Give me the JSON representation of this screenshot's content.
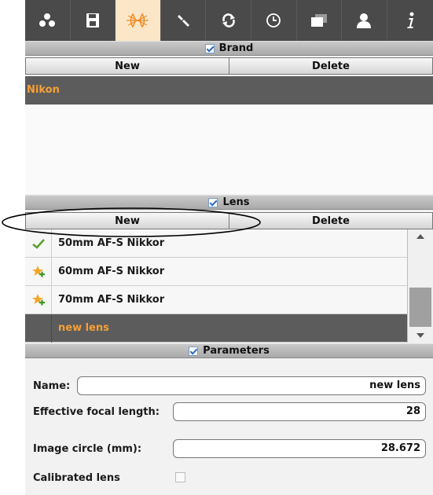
{
  "toolbar": {
    "tabs": [
      {
        "icon": "nodes-icon"
      },
      {
        "icon": "save-icon"
      },
      {
        "icon": "lens-icon",
        "active": true
      },
      {
        "icon": "wrench-icon"
      },
      {
        "icon": "refresh-icon"
      },
      {
        "icon": "clock-icon"
      },
      {
        "icon": "windows-icon"
      },
      {
        "icon": "user-icon"
      },
      {
        "icon": "info-icon"
      }
    ]
  },
  "brand": {
    "header": "Brand",
    "checked": true,
    "new_label": "New",
    "delete_label": "Delete",
    "items": [
      {
        "name": "Nikon",
        "selected": true
      }
    ]
  },
  "lens": {
    "header": "Lens",
    "checked": true,
    "new_label": "New",
    "delete_label": "Delete",
    "items": [
      {
        "name": "50mm AF-S Nikkor",
        "status_icon": "checkmark-icon"
      },
      {
        "name": "60mm AF-S Nikkor",
        "status_icon": "star-plus-icon"
      },
      {
        "name": "70mm AF-S Nikkor",
        "status_icon": "star-plus-icon"
      },
      {
        "name": "new lens",
        "status_icon": "",
        "selected": true
      }
    ]
  },
  "parameters": {
    "header": "Parameters",
    "checked": true,
    "name_label": "Name:",
    "name_value": "new lens",
    "focal_label": "Effective focal length:",
    "focal_value": "28",
    "circle_label": "Image circle (mm):",
    "circle_value": "28.672",
    "calibrated_label": "Calibrated lens",
    "calibrated_checked": false
  },
  "colors": {
    "selection_bg": "#5c5c5c",
    "selection_text": "#f7a035",
    "toolbar_bg": "#4a4a4a",
    "active_tab_bg": "#fbe6c7"
  }
}
